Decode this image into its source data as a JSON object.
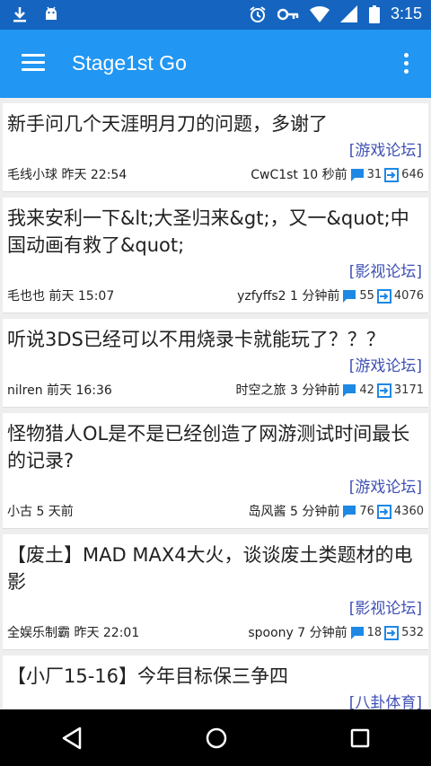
{
  "status_bar": {
    "time": "3:15"
  },
  "app_bar": {
    "title": "Stage1st Go"
  },
  "threads": [
    {
      "title": "新手问几个天涯明月刀的问题，多谢了",
      "forum": "[游戏论坛]",
      "author_time": "毛线小球 昨天 22:54",
      "last_reply": "CwC1st 10 秒前",
      "replies": "31",
      "views": "646"
    },
    {
      "title": "我来安利一下&lt;大圣归来&gt;，又一&quot;中国动画有救了&quot;",
      "forum": "[影视论坛]",
      "author_time": "毛也也 前天 15:07",
      "last_reply": "yzfyffs2 1 分钟前",
      "replies": "55",
      "views": "4076"
    },
    {
      "title": "听说3DS已经可以不用烧录卡就能玩了？？？",
      "forum": "[游戏论坛]",
      "author_time": "nilren 前天 16:36",
      "last_reply": "时空之旅 3 分钟前",
      "replies": "42",
      "views": "3171"
    },
    {
      "title": "怪物猎人OL是不是已经创造了网游测试时间最长的记录?",
      "forum": "[游戏论坛]",
      "author_time": "小古 5 天前",
      "last_reply": "岛风酱 5 分钟前",
      "replies": "76",
      "views": "4360"
    },
    {
      "title": "【废土】MAD MAX4大火，谈谈废土类题材的电影",
      "forum": "[影视论坛]",
      "author_time": "全娱乐制霸 昨天 22:01",
      "last_reply": "spoony 7 分钟前",
      "replies": "18",
      "views": "532"
    },
    {
      "title": "【小厂15-16】今年目标保三争四",
      "forum": "[八卦体育]",
      "author_time": "",
      "last_reply": "",
      "replies": "",
      "views": ""
    }
  ]
}
